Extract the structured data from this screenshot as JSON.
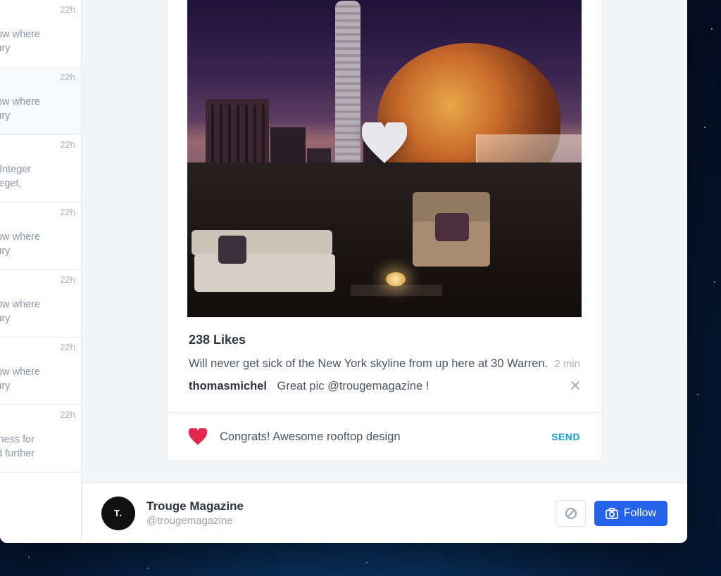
{
  "feed": {
    "items": [
      {
        "time": "22h",
        "text": "now where\nxury"
      },
      {
        "time": "22h",
        "text": "now where\nxury"
      },
      {
        "time": "22h",
        "text": "t. Integer\nit eget,"
      },
      {
        "time": "22h",
        "text": "now where\nxury"
      },
      {
        "time": "22h",
        "text": "now where\nxury"
      },
      {
        "time": "22h",
        "text": "now where\nxury"
      },
      {
        "time": "22h",
        "text": "siness for\ned further"
      }
    ],
    "active_index": 1
  },
  "post": {
    "likes_label": "238 Likes",
    "caption": "Will never get sick of the New York skyline from up here at 30 Warren.",
    "time_ago": "2 min",
    "comment": {
      "user": "thomasmichel",
      "text": "Great pic @trougemagazine !"
    },
    "compose": {
      "value": "Congrats! Awesome rooftop design",
      "send_label": "SEND"
    }
  },
  "profile": {
    "avatar_initials": "T.",
    "name": "Trouge Magazine",
    "handle": "@trougemagazine",
    "follow_label": "Follow"
  }
}
